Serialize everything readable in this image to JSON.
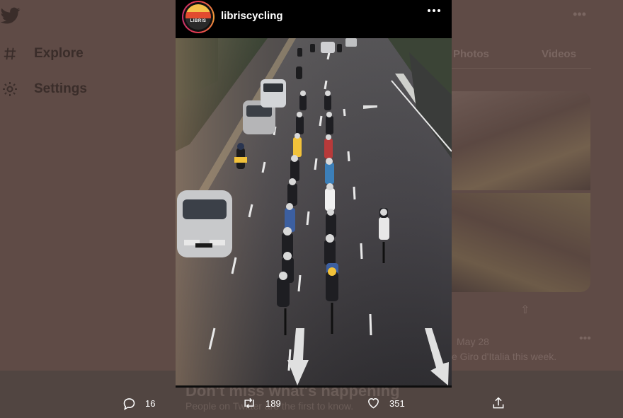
{
  "background": {
    "nav": [
      {
        "label": "Explore",
        "icon": "hashtag-icon"
      },
      {
        "label": "Settings",
        "icon": "gear-icon"
      }
    ],
    "tabs": [
      "Photos",
      "Videos"
    ],
    "tweet_date": "May 28",
    "tweet_text": "e Giro d'Italia this week.",
    "banner_title": "Don't miss what's happening",
    "banner_subtitle": "People on Twitter are the first to know."
  },
  "post": {
    "username": "libriscycling",
    "avatar_text": "LIBRIS"
  },
  "actions": {
    "replies": "16",
    "retweets": "189",
    "likes": "351"
  },
  "colors": {
    "overlay": "#5f4b46",
    "post_bg": "#000000",
    "road": "#3c3a3c",
    "accent_yellow": "#f2c23a"
  }
}
